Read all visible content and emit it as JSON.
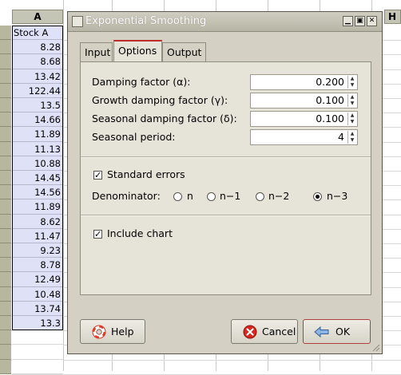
{
  "spreadsheet": {
    "column_a": "A",
    "column_h": "H",
    "header_cell": "Stock A",
    "values": [
      "8.28",
      "8.68",
      "13.42",
      "122.44",
      "13.5",
      "14.66",
      "11.89",
      "11.13",
      "10.88",
      "14.45",
      "14.56",
      "11.89",
      "8.62",
      "11.47",
      "9.23",
      "8.78",
      "12.49",
      "10.48",
      "13.74",
      "13.3"
    ]
  },
  "dialog": {
    "title": "Exponential Smoothing",
    "tabs": {
      "input": "Input",
      "options": "Options",
      "output": "Output"
    },
    "options": {
      "damping_label": "Damping factor (α):",
      "damping_value": "0.200",
      "growth_label": "Growth damping factor (γ):",
      "growth_value": "0.100",
      "seasonal_label": "Seasonal damping factor (δ):",
      "seasonal_value": "0.100",
      "period_label": "Seasonal period:",
      "period_value": "4",
      "standard_errors_label": "Standard errors",
      "standard_errors_checked": true,
      "denominator_label": "Denominator:",
      "denominator_options": [
        "n",
        "n−1",
        "n−2",
        "n−3"
      ],
      "denominator_selected": "n−3",
      "include_chart_label": "Include chart",
      "include_chart_checked": true
    },
    "buttons": {
      "help": "Help",
      "cancel": "Cancel",
      "ok": "OK"
    }
  }
}
